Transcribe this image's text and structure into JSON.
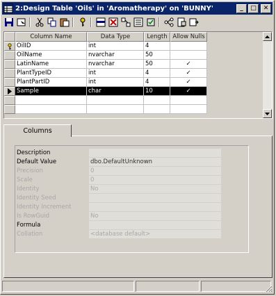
{
  "window": {
    "title": "2:Design Table 'Oils' in 'Aromatherapy' on 'BUNNY'",
    "controls": [
      "minimize",
      "maximize",
      "close"
    ]
  },
  "toolbar": {
    "buttons": [
      "save-icon",
      "properties-icon",
      "cut-icon",
      "copy-icon",
      "paste-icon",
      "primary-key-icon",
      "insert-column-icon",
      "delete-column-icon",
      "manage-relationships-icon",
      "manage-indexes-icon",
      "manage-constraints-icon",
      "manage-triggers-icon",
      "generate-script-icon"
    ]
  },
  "grid": {
    "headers": [
      "Column Name",
      "Data Type",
      "Length",
      "Allow Nulls"
    ],
    "rows": [
      {
        "name": "OilID",
        "type": "int",
        "length": "4",
        "nulls": "",
        "marker": "key"
      },
      {
        "name": "OilName",
        "type": "nvarchar",
        "length": "50",
        "nulls": "",
        "marker": ""
      },
      {
        "name": "LatinName",
        "type": "nvarchar",
        "length": "50",
        "nulls": "✓",
        "marker": ""
      },
      {
        "name": "PlantTypeID",
        "type": "int",
        "length": "4",
        "nulls": "✓",
        "marker": ""
      },
      {
        "name": "PlantPartID",
        "type": "int",
        "length": "4",
        "nulls": "✓",
        "marker": ""
      },
      {
        "name": "Sample",
        "type": "char",
        "length": "10",
        "nulls": "✓",
        "marker": "current"
      }
    ]
  },
  "tabs": [
    "Columns"
  ],
  "properties": [
    {
      "label": "Description",
      "value": "",
      "disabled": false
    },
    {
      "label": "Default Value",
      "value": "dbo.DefaultUnknown",
      "disabled": false
    },
    {
      "label": "Precision",
      "value": "0",
      "disabled": true
    },
    {
      "label": "Scale",
      "value": "0",
      "disabled": true
    },
    {
      "label": "Identity",
      "value": "No",
      "disabled": true
    },
    {
      "label": "Identity Seed",
      "value": "",
      "disabled": true
    },
    {
      "label": "Identity Increment",
      "value": "",
      "disabled": true
    },
    {
      "label": "Is RowGuid",
      "value": "No",
      "disabled": true
    },
    {
      "label": "Formula",
      "value": "",
      "disabled": false
    },
    {
      "label": "Collation",
      "value": "<database default>",
      "disabled": true
    }
  ],
  "colors": {
    "titlebar": "#0a246a",
    "face": "#d4d0c8",
    "selection": "#000000"
  }
}
